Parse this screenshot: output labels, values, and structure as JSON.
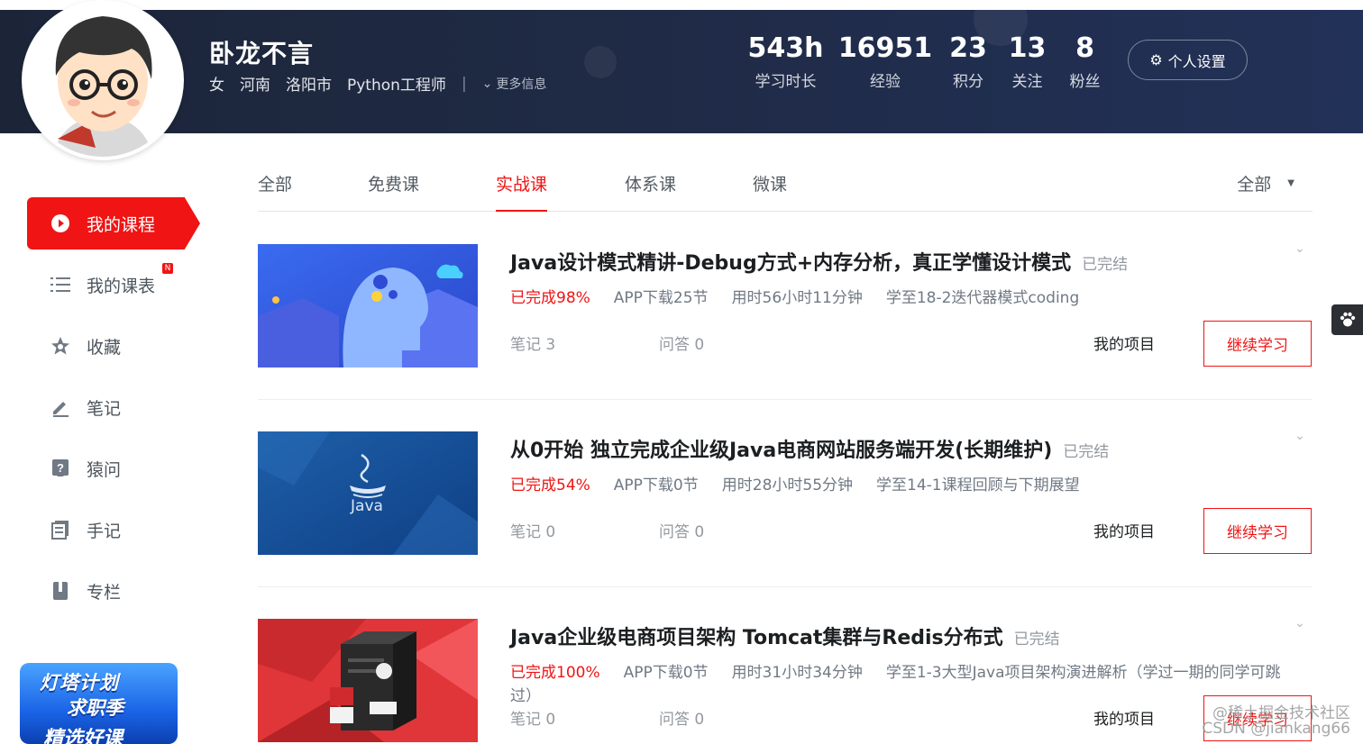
{
  "user": {
    "name": "卧龙不言",
    "gender": "女",
    "province": "河南",
    "city": "洛阳市",
    "job": "Python工程师",
    "separator": "|",
    "more_label": "更多信息"
  },
  "stats": [
    {
      "value": "543h",
      "label": "学习时长"
    },
    {
      "value": "16951",
      "label": "经验"
    },
    {
      "value": "23",
      "label": "积分"
    },
    {
      "value": "13",
      "label": "关注"
    },
    {
      "value": "8",
      "label": "粉丝"
    }
  ],
  "settings_label": "个人设置",
  "sidebar": {
    "items": [
      {
        "label": "我的课程",
        "icon": "play-circle-icon"
      },
      {
        "label": "我的课表",
        "icon": "list-icon",
        "badge": "N"
      },
      {
        "label": "收藏",
        "icon": "star-icon"
      },
      {
        "label": "笔记",
        "icon": "pen-icon"
      },
      {
        "label": "猿问",
        "icon": "question-icon"
      },
      {
        "label": "手记",
        "icon": "notebook-icon"
      },
      {
        "label": "专栏",
        "icon": "column-icon"
      }
    ],
    "promo": {
      "line1": "灯塔计划",
      "line2": "求职季",
      "line3": "精选好课"
    }
  },
  "tabs": [
    "全部",
    "免费课",
    "实战课",
    "体系课",
    "微课"
  ],
  "active_tab": "实战课",
  "filter_label": "全部",
  "courses": [
    {
      "title": "Java设计模式精讲-Debug方式+内存分析，真正学懂设计模式",
      "status": "已完结",
      "progress": "已完成98%",
      "app_download": "APP下载25节",
      "time_used": "用时56小时11分钟",
      "learned_to": "学至18-2迭代器模式coding",
      "notes": "笔记 3",
      "qa": "问答 0",
      "project": "我的项目",
      "continue": "继续学习"
    },
    {
      "title": "从0开始 独立完成企业级Java电商网站服务端开发(长期维护)",
      "status": "已完结",
      "progress": "已完成54%",
      "app_download": "APP下载0节",
      "time_used": "用时28小时55分钟",
      "learned_to": "学至14-1课程回顾与下期展望",
      "notes": "笔记 0",
      "qa": "问答 0",
      "project": "我的项目",
      "continue": "继续学习",
      "thumb_text": "Java"
    },
    {
      "title": "Java企业级电商项目架构 Tomcat集群与Redis分布式",
      "status": "已完结",
      "progress": "已完成100%",
      "app_download": "APP下载0节",
      "time_used": "用时31小时34分钟",
      "learned_to": "学至1-3大型Java项目架构演进解析（学过一期的同学可跳过）",
      "notes": "笔记 0",
      "qa": "问答 0",
      "project": "我的项目",
      "continue": "继续学习"
    }
  ],
  "watermark": {
    "line1": "@稀土掘金技术社区",
    "line2": "CSDN @jiankang66"
  },
  "colors": {
    "accent": "#f01414",
    "banner": "#1f2a45",
    "text_secondary": "#707984"
  }
}
